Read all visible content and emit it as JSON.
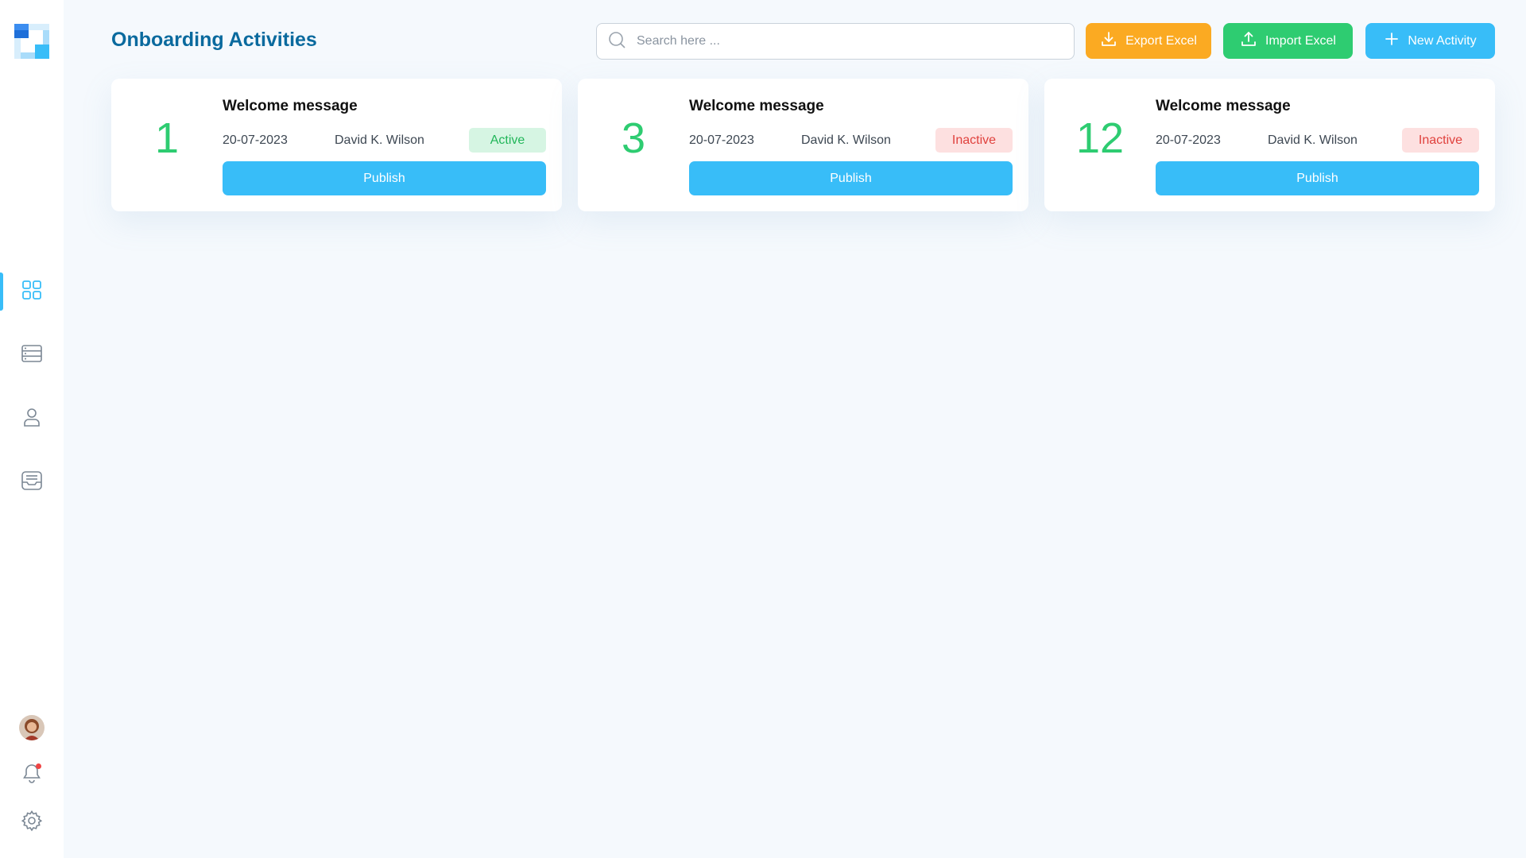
{
  "header": {
    "title": "Onboarding Activities",
    "search_placeholder": "Search here ...",
    "export_label": "Export Excel",
    "import_label": "Import Excel",
    "new_label": "New Activity"
  },
  "sidebar": {
    "items": [
      {
        "icon": "dashboard-grid-icon",
        "active": true
      },
      {
        "icon": "database-icon",
        "active": false
      },
      {
        "icon": "user-icon",
        "active": false
      },
      {
        "icon": "inbox-icon",
        "active": false
      }
    ],
    "bottom": [
      "avatar",
      "bell-icon",
      "gear-icon"
    ],
    "has_notification": true
  },
  "cards": [
    {
      "number": "1",
      "title": "Welcome message",
      "date": "20-07-2023",
      "author": "David K. Wilson",
      "status": "Active",
      "action": "Publish"
    },
    {
      "number": "3",
      "title": "Welcome message",
      "date": "20-07-2023",
      "author": "David K. Wilson",
      "status": "Inactive",
      "action": "Publish"
    },
    {
      "number": "12",
      "title": "Welcome message",
      "date": "20-07-2023",
      "author": "David K. Wilson",
      "status": "Inactive",
      "action": "Publish"
    }
  ],
  "colors": {
    "accent": "#38bdf8",
    "title": "#0a6a9e",
    "export": "#fbaa22",
    "import": "#2ecc71",
    "active_badge": "#22b65a",
    "inactive_badge": "#e0413d"
  }
}
